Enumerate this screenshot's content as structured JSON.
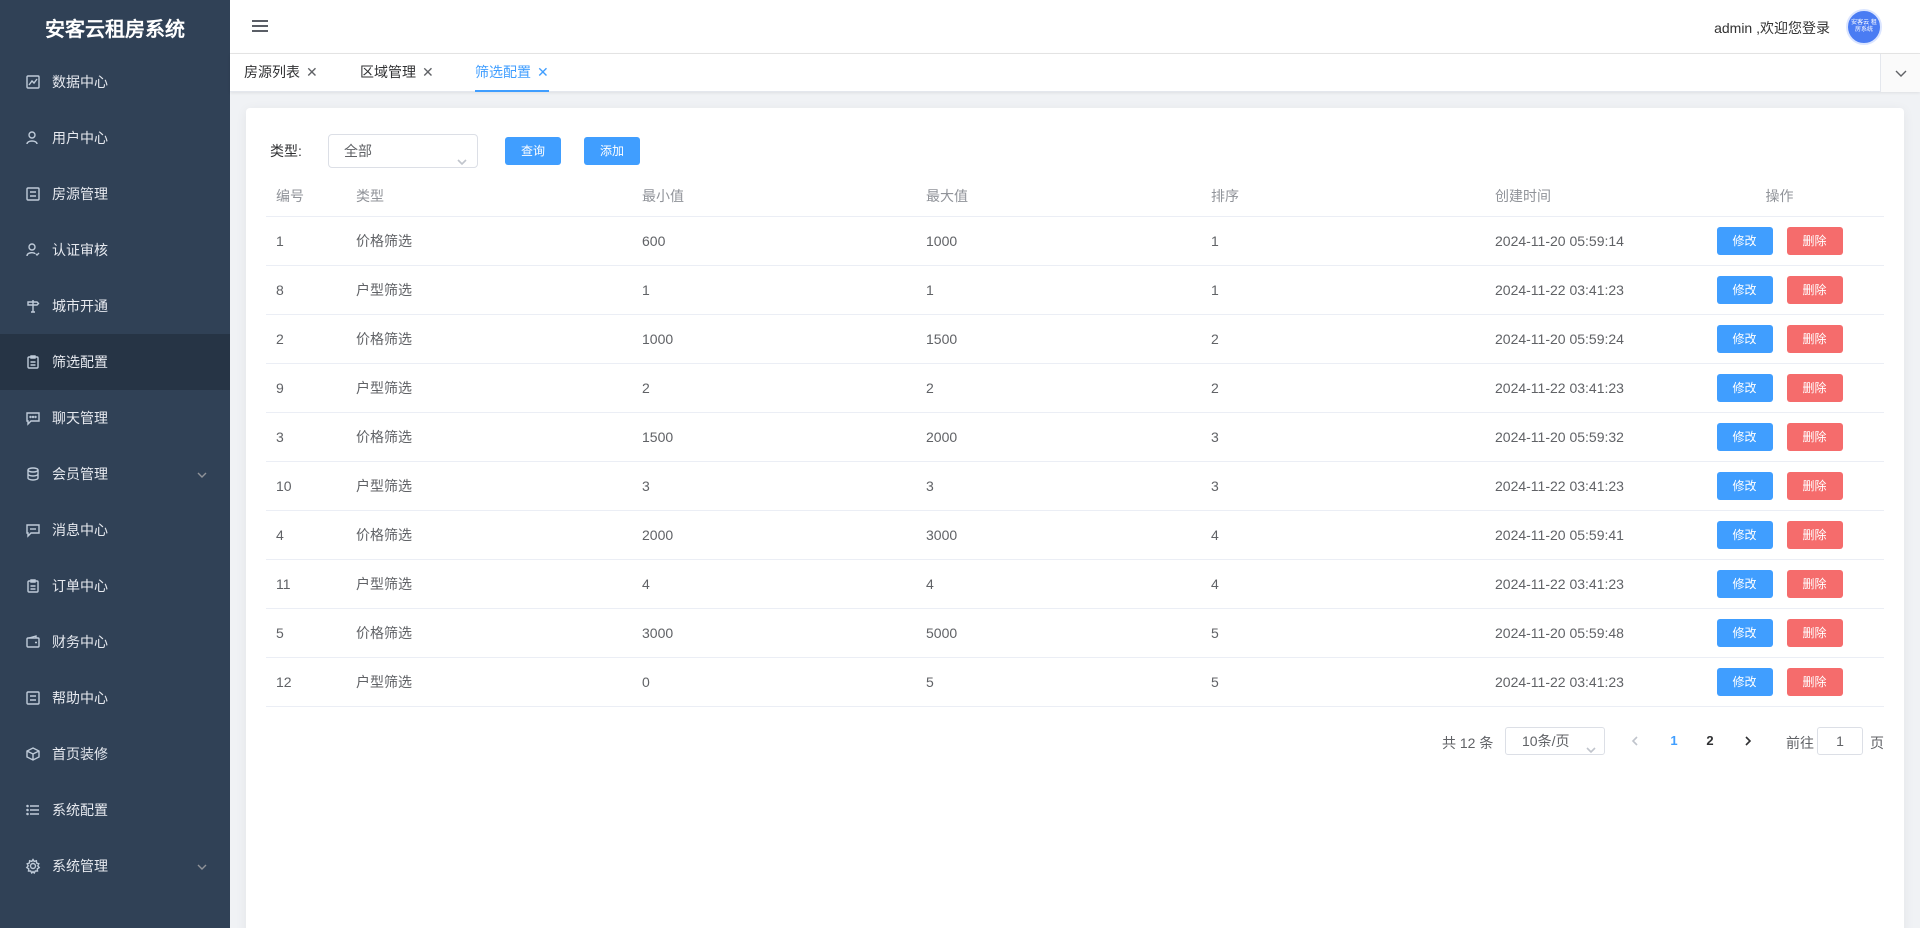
{
  "app": {
    "title": "安客云租房系统",
    "welcome": "admin ,欢迎您登录",
    "avatar_text": "安客云 租房系统"
  },
  "sidebar": {
    "items": [
      {
        "label": "数据中心",
        "icon": "chart-icon"
      },
      {
        "label": "用户中心",
        "icon": "user-icon"
      },
      {
        "label": "房源管理",
        "icon": "list-icon"
      },
      {
        "label": "认证审核",
        "icon": "user-check-icon"
      },
      {
        "label": "城市开通",
        "icon": "signpost-icon"
      },
      {
        "label": "筛选配置",
        "icon": "clipboard-icon",
        "active": true
      },
      {
        "label": "聊天管理",
        "icon": "chat-icon"
      },
      {
        "label": "会员管理",
        "icon": "database-icon",
        "has_submenu": true
      },
      {
        "label": "消息中心",
        "icon": "message-icon"
      },
      {
        "label": "订单中心",
        "icon": "clipboard-icon"
      },
      {
        "label": "财务中心",
        "icon": "wallet-icon"
      },
      {
        "label": "帮助中心",
        "icon": "list-icon"
      },
      {
        "label": "首页装修",
        "icon": "box-icon"
      },
      {
        "label": "系统配置",
        "icon": "menu-list-icon"
      },
      {
        "label": "系统管理",
        "icon": "gear-icon",
        "has_submenu": true
      }
    ]
  },
  "tabs": [
    {
      "label": "房源列表",
      "active": false
    },
    {
      "label": "区域管理",
      "active": false
    },
    {
      "label": "筛选配置",
      "active": true
    }
  ],
  "filter": {
    "label": "类型:",
    "select_value": "全部",
    "query_label": "查询",
    "add_label": "添加"
  },
  "table": {
    "headers": [
      "编号",
      "类型",
      "最小值",
      "最大值",
      "排序",
      "创建时间",
      "操作"
    ],
    "edit_label": "修改",
    "delete_label": "删除",
    "rows": [
      [
        "1",
        "价格筛选",
        "600",
        "1000",
        "1",
        "2024-11-20 05:59:14"
      ],
      [
        "8",
        "户型筛选",
        "1",
        "1",
        "1",
        "2024-11-22 03:41:23"
      ],
      [
        "2",
        "价格筛选",
        "1000",
        "1500",
        "2",
        "2024-11-20 05:59:24"
      ],
      [
        "9",
        "户型筛选",
        "2",
        "2",
        "2",
        "2024-11-22 03:41:23"
      ],
      [
        "3",
        "价格筛选",
        "1500",
        "2000",
        "3",
        "2024-11-20 05:59:32"
      ],
      [
        "10",
        "户型筛选",
        "3",
        "3",
        "3",
        "2024-11-22 03:41:23"
      ],
      [
        "4",
        "价格筛选",
        "2000",
        "3000",
        "4",
        "2024-11-20 05:59:41"
      ],
      [
        "11",
        "户型筛选",
        "4",
        "4",
        "4",
        "2024-11-22 03:41:23"
      ],
      [
        "5",
        "价格筛选",
        "3000",
        "5000",
        "5",
        "2024-11-20 05:59:48"
      ],
      [
        "12",
        "户型筛选",
        "0",
        "5",
        "5",
        "2024-11-22 03:41:23"
      ]
    ]
  },
  "pagination": {
    "total": "共 12 条",
    "page_size": "10条/页",
    "current_page": "1",
    "other_page": "2",
    "goto_label": "前往",
    "goto_value": "1",
    "page_suffix": "页"
  },
  "colors": {
    "sidebar_bg": "#304156",
    "primary": "#409eff",
    "danger": "#f56c6c"
  }
}
